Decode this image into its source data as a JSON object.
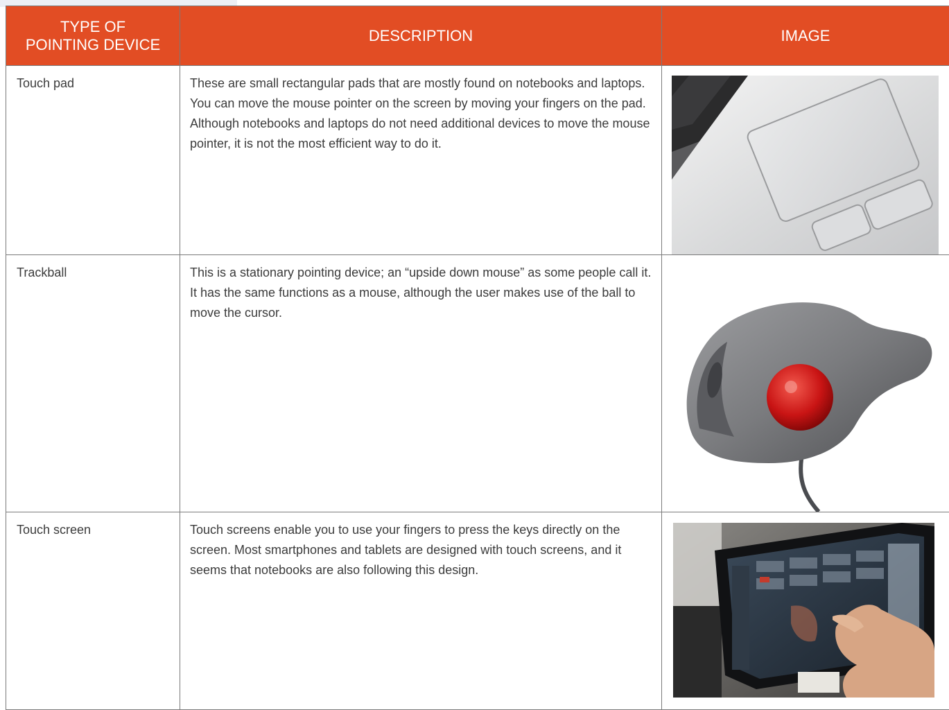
{
  "table": {
    "headers": {
      "type": "TYPE OF\nPOINTING DEVICE",
      "description": "DESCRIPTION",
      "image": "IMAGE"
    },
    "rows": [
      {
        "type": "Touch pad",
        "description": "These are small rectangular pads that are mostly found on notebooks and laptops. You can move the mouse pointer on the screen by moving your fingers on the pad. Although notebooks and laptops do not need additional devices to move the mouse pointer, it is not the most efficient way to do it.",
        "image": "touch-pad-photo"
      },
      {
        "type": "Trackball",
        "description": "This is a stationary pointing device; an “upside down mouse” as some people call it. It has the same functions as a mouse, although the user makes use of the ball to move the cursor.",
        "image": "trackball-photo"
      },
      {
        "type": "Touch screen",
        "description": "Touch screens enable you to use your fingers to press the keys directly on the screen. Most smartphones and tablets are designed with touch screens, and it seems that notebooks are also following this design.",
        "image": "touch-screen-photo"
      }
    ]
  },
  "colors": {
    "header_bg": "#e24d24",
    "header_text": "#ffffff",
    "body_text": "#3b3b3b",
    "border": "#7a7a7a"
  }
}
